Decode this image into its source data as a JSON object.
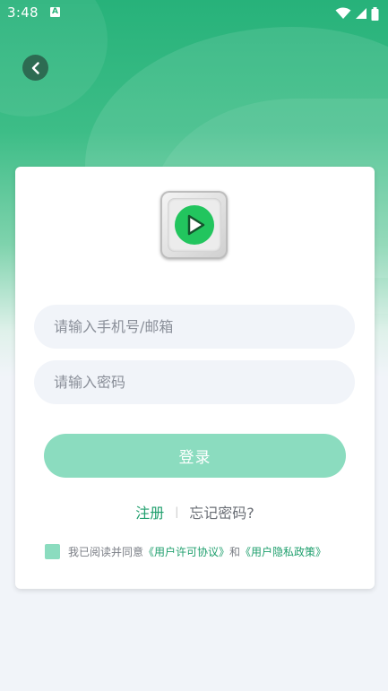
{
  "statusbar": {
    "time": "3:48",
    "app_badge": "A"
  },
  "login": {
    "phone_placeholder": "请输入手机号/邮箱",
    "password_placeholder": "请输入密码",
    "login_label": "登录",
    "register_label": "注册",
    "separator": "|",
    "forgot_label": "忘记密码?"
  },
  "agreement": {
    "prefix": "我已阅读并同意",
    "user_agreement": "《用户许可协议》",
    "and": "和",
    "privacy_policy": "《用户隐私政策》"
  },
  "colors": {
    "brand_green": "#27b27a",
    "button_green": "#8bdcbf",
    "link_green": "#1f9f6d",
    "logo_green": "#22c55e"
  },
  "icons": [
    "back-arrow-icon",
    "wifi-icon",
    "signal-icon",
    "battery-icon",
    "play-icon"
  ]
}
